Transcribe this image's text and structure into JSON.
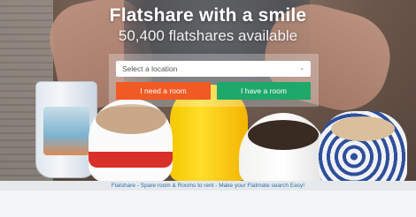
{
  "hero": {
    "title": "Flatshare with a smile",
    "subtitle": "50,400 flatshares available"
  },
  "search": {
    "location_placeholder": "Select a location",
    "chevron_icon": "chevron-down-icon",
    "need_room_label": "I need a room",
    "have_room_label": "I have a room"
  },
  "footer": {
    "tagline": "Flatshare - Spare room & Rooms to rent - Make your Flatmate search Easy!"
  },
  "colors": {
    "need_button": "#f15a23",
    "have_button": "#1ea86a",
    "link": "#2a6fb0"
  }
}
